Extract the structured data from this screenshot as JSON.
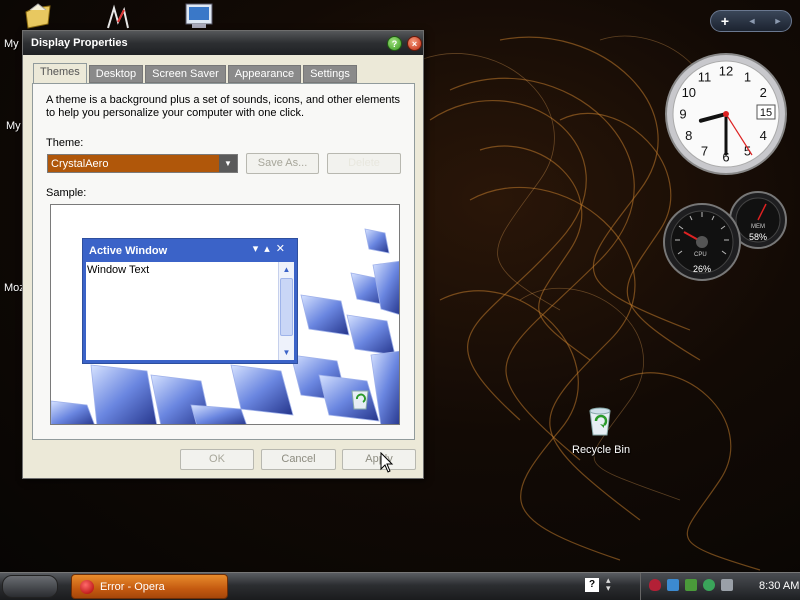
{
  "desktop": {
    "icon_labels": [
      "My",
      "My",
      "Moz"
    ],
    "recycle_bin_label": "Recycle Bin"
  },
  "gadgets": {
    "add_symbol": "+",
    "prev_symbol": "◄",
    "next_symbol": "►",
    "clock": {
      "hours": 8,
      "minutes": 30,
      "date": "15"
    },
    "cpu_meter": {
      "cpu_label": "CPU",
      "cpu_value": "26%",
      "mem_label": "MEM",
      "mem_value": "58%"
    }
  },
  "window": {
    "title": "Display Properties",
    "help_symbol": "?",
    "close_symbol": "×",
    "tabs": [
      {
        "label": "Themes",
        "active": true
      },
      {
        "label": "Desktop",
        "active": false
      },
      {
        "label": "Screen Saver",
        "active": false
      },
      {
        "label": "Appearance",
        "active": false
      },
      {
        "label": "Settings",
        "active": false
      }
    ],
    "intro_text": "A theme is a background plus a set of sounds, icons, and other elements to help you personalize your computer with one click.",
    "theme_label": "Theme:",
    "theme_value": "CrystalAero",
    "save_as_label": "Save As...",
    "delete_label": "Delete",
    "sample_label": "Sample:",
    "preview": {
      "title": "Active Window",
      "controls": "▾▴✕",
      "body_text": "Window Text"
    },
    "ok_label": "OK",
    "cancel_label": "Cancel",
    "apply_label": "Apply"
  },
  "taskbar": {
    "task_label": "Error - Opera",
    "help_symbol": "?",
    "clock": "8:30 AM"
  },
  "colors": {
    "accent": "#b0570a",
    "taskbar_task": "#c45a10",
    "preview_blue": "#3b63c8"
  }
}
